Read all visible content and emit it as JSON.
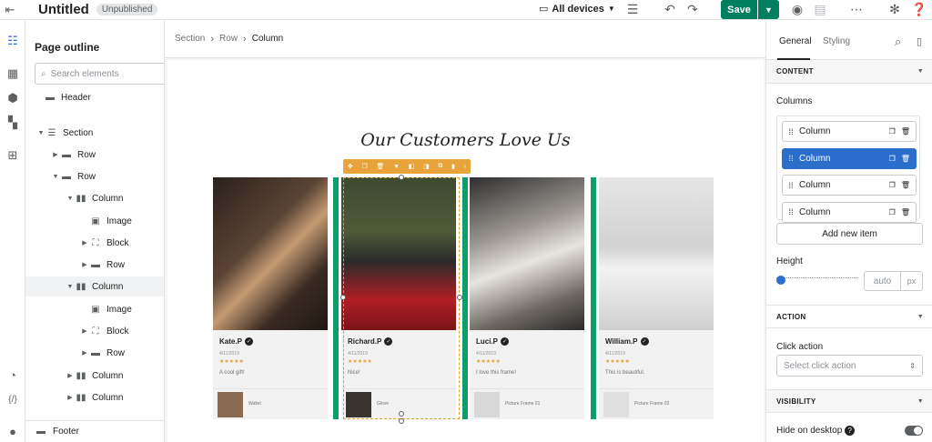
{
  "topbar": {
    "title": "Untitled",
    "status_badge": "Unpublished",
    "device_select": "All devices",
    "save_label": "Save",
    "icons": [
      "exit-icon",
      "monitor-icon",
      "sliders-icon",
      "undo-icon",
      "redo-icon",
      "eye-icon",
      "layout-icon",
      "more-icon",
      "settings-icon",
      "help-icon"
    ]
  },
  "rail": {
    "icons": [
      "outline-icon",
      "media-icon",
      "shopify-icon",
      "apps-icon",
      "add-section-icon",
      "history-icon",
      "code-icon",
      "chat-icon"
    ]
  },
  "outline": {
    "title": "Page outline",
    "search_placeholder": "Search elements",
    "nodes": [
      {
        "label": "Header",
        "icon": "header-icon",
        "depth": 0,
        "caret": "",
        "selected": false
      },
      {
        "label": "Section",
        "icon": "section-icon",
        "depth": 1,
        "caret": "down",
        "selected": false
      },
      {
        "label": "Row",
        "icon": "row-icon",
        "depth": 2,
        "caret": "right",
        "selected": false
      },
      {
        "label": "Row",
        "icon": "row-icon",
        "depth": 2,
        "caret": "down",
        "selected": false
      },
      {
        "label": "Column",
        "icon": "column-icon",
        "depth": 3,
        "caret": "down",
        "selected": false
      },
      {
        "label": "Image",
        "icon": "image-icon",
        "depth": 4,
        "caret": "",
        "selected": false
      },
      {
        "label": "Block",
        "icon": "block-icon",
        "depth": 4,
        "caret": "right",
        "selected": false
      },
      {
        "label": "Row",
        "icon": "row-icon",
        "depth": 4,
        "caret": "right",
        "selected": false
      },
      {
        "label": "Column",
        "icon": "column-icon",
        "depth": 3,
        "caret": "down",
        "selected": true
      },
      {
        "label": "Image",
        "icon": "image-icon",
        "depth": 4,
        "caret": "",
        "selected": false
      },
      {
        "label": "Block",
        "icon": "block-icon",
        "depth": 4,
        "caret": "right",
        "selected": false
      },
      {
        "label": "Row",
        "icon": "row-icon",
        "depth": 4,
        "caret": "right",
        "selected": false
      },
      {
        "label": "Column",
        "icon": "column-icon",
        "depth": 3,
        "caret": "right",
        "selected": false
      },
      {
        "label": "Column",
        "icon": "column-icon",
        "depth": 3,
        "caret": "right",
        "selected": false
      }
    ],
    "footer_label": "Footer"
  },
  "breadcrumb": [
    "Section",
    "Row",
    "Column"
  ],
  "canvas": {
    "heading": "Our Customers Love Us",
    "cards": [
      {
        "name": "Kate.P",
        "date": "4/11/2019",
        "stars": "★★★★★",
        "review": "A cool gift!",
        "product": "Wallet"
      },
      {
        "name": "Richard.P",
        "date": "4/11/2019",
        "stars": "★★★★★",
        "review": "Nice!",
        "product": "Glove"
      },
      {
        "name": "Luci.P",
        "date": "4/11/2019",
        "stars": "★★★★★",
        "review": "I love this frame!",
        "product": "Picture Frame 01"
      },
      {
        "name": "William.P",
        "date": "4/11/2019",
        "stars": "★★★★★",
        "review": "This is beautiful.",
        "product": "Picture Frame 02"
      }
    ]
  },
  "settings": {
    "tab_general": "General",
    "tab_styling": "Styling",
    "content_section": "CONTENT",
    "columns_label": "Columns",
    "columns": [
      {
        "label": "Column",
        "selected": false
      },
      {
        "label": "Column",
        "selected": true
      },
      {
        "label": "Column",
        "selected": false
      },
      {
        "label": "Column",
        "selected": false
      }
    ],
    "add_item": "Add new item",
    "height_label": "Height",
    "height_placeholder": "auto",
    "height_unit": "px",
    "action_section": "ACTION",
    "click_action_label": "Click action",
    "click_action_placeholder": "Select click action",
    "visibility_section": "VISIBILITY",
    "hide_desktop_label": "Hide on desktop",
    "hide_desktop_on": false
  },
  "colors": {
    "accent": "#007f5f",
    "selection": "#2c6ecb",
    "divider": "#0d9e6a",
    "toolbar": "#e8a33a"
  }
}
